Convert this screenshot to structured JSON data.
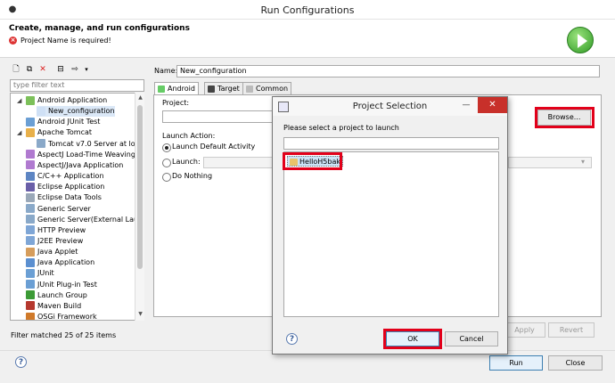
{
  "window": {
    "title": "Run Configurations"
  },
  "header": {
    "title": "Create, manage, and run configurations",
    "error": "Project Name is required!"
  },
  "left": {
    "filter_placeholder": "type filter text",
    "tree": [
      {
        "label": "Android Application",
        "icon": "android-icon",
        "level": 1,
        "expanded": true
      },
      {
        "label": "New_configuration",
        "icon": "config-icon",
        "level": 2,
        "selected": true
      },
      {
        "label": "Android JUnit Test",
        "icon": "junit-icon",
        "level": 1
      },
      {
        "label": "Apache Tomcat",
        "icon": "tomcat-icon",
        "level": 1,
        "expanded": true
      },
      {
        "label": "Tomcat v7.0 Server at loca",
        "icon": "server-icon",
        "level": 2
      },
      {
        "label": "AspectJ Load-Time Weaving A",
        "icon": "aspectj-icon",
        "level": 1
      },
      {
        "label": "AspectJ/Java Application",
        "icon": "aspectj-icon",
        "level": 1
      },
      {
        "label": "C/C++ Application",
        "icon": "cpp-icon",
        "level": 1
      },
      {
        "label": "Eclipse Application",
        "icon": "eclipse-icon",
        "level": 1
      },
      {
        "label": "Eclipse Data Tools",
        "icon": "datatools-icon",
        "level": 1
      },
      {
        "label": "Generic Server",
        "icon": "server-icon",
        "level": 1
      },
      {
        "label": "Generic Server(External Launch",
        "icon": "server-icon",
        "level": 1
      },
      {
        "label": "HTTP Preview",
        "icon": "preview-icon",
        "level": 1
      },
      {
        "label": "J2EE Preview",
        "icon": "preview-icon",
        "level": 1
      },
      {
        "label": "Java Applet",
        "icon": "applet-icon",
        "level": 1
      },
      {
        "label": "Java Application",
        "icon": "java-icon",
        "level": 1
      },
      {
        "label": "JUnit",
        "icon": "junit-icon",
        "level": 1
      },
      {
        "label": "JUnit Plug-in Test",
        "icon": "junit-icon",
        "level": 1
      },
      {
        "label": "Launch Group",
        "icon": "launch-icon",
        "level": 1
      },
      {
        "label": "Maven Build",
        "icon": "maven-icon",
        "level": 1
      },
      {
        "label": "OSGi Framework",
        "icon": "osgi-icon",
        "level": 1
      }
    ],
    "filter_status": "Filter matched 25 of 25 items"
  },
  "right": {
    "name_label": "Name:",
    "name_value": "New_configuration",
    "tabs": [
      {
        "label": "Android",
        "active": true
      },
      {
        "label": "Target",
        "active": false
      },
      {
        "label": "Common",
        "active": false
      }
    ],
    "project_label": "Project:",
    "browse_label": "Browse...",
    "launch_action_label": "Launch Action:",
    "radio_default": "Launch Default Activity",
    "radio_launch": "Launch:",
    "radio_nothing": "Do Nothing",
    "apply_label": "Apply",
    "revert_label": "Revert"
  },
  "footer": {
    "run_label": "Run",
    "close_label": "Close"
  },
  "modal": {
    "title": "Project Selection",
    "prompt": "Please select a project to launch",
    "items": [
      "HelloH5bak"
    ],
    "ok_label": "OK",
    "cancel_label": "Cancel"
  },
  "colors": {
    "highlight": "#e2001a",
    "close_button": "#c8302a",
    "run_green": "#2f9a25"
  }
}
